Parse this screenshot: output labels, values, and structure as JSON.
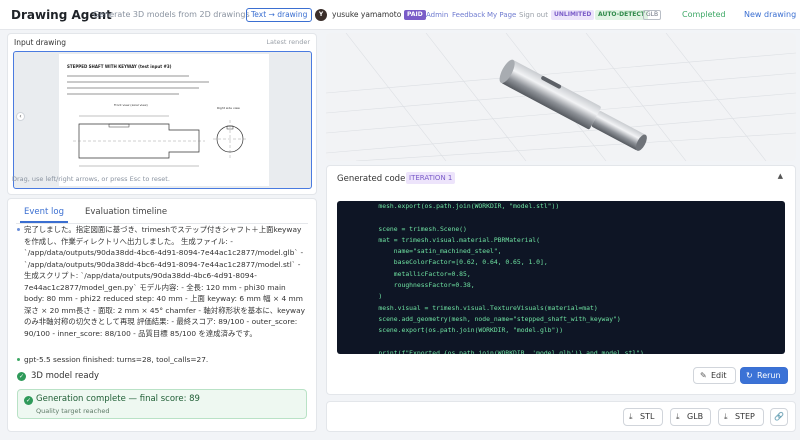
{
  "header": {
    "title": "Drawing Agent",
    "subtitle": "Generate 3D models from 2D drawings",
    "mode": "Text → drawing",
    "avatar_initial": "Y",
    "user_name": "yusuke yamamoto",
    "paid_badge": "PAID",
    "links": {
      "admin": "Admin",
      "feedback": "Feedback",
      "my_page": "My Page",
      "sign_out": "Sign out"
    },
    "unlimited_badge": "UNLIMITED",
    "auto_detect_badge": "AUTO-DETECT",
    "glb_badge": "GLB",
    "status": "Completed",
    "new_drawing": "New drawing",
    "status_color": "#3ea866",
    "accent": "#3b6fd1"
  },
  "input_drawing": {
    "label": "Input drawing",
    "latest": "Latest render",
    "drawing_title": "STEPPED SHAFT WITH KEYWAY (test input #3)",
    "front_view": "Front view (axial view)",
    "right_view": "Right side view",
    "hint": "Drag, use left/right arrows, or press Esc to reset."
  },
  "event_log": {
    "tabs": [
      "Event log",
      "Evaluation timeline"
    ],
    "entries": [
      {
        "text": "完了しました。指定図面に基づき、trimeshでステップ付きシャフト＋上面keywayを作成し、作業ディレクトリへ出力しました。 生成ファイル: - `/app/data/outputs/90da38dd-4bc6-4d91-8094-7e44ac1c2877/model.glb` - `/app/data/outputs/90da38dd-4bc6-4d91-8094-7e44ac1c2877/model.stl` - 生成スクリプト: `/app/data/outputs/90da38dd-4bc6-4d91-8094-7e44ac1c2877/model_gen.py` モデル内容: - 全長: 120 mm - phi30 main body: 80 mm - phi22 reduced step: 40 mm - 上面 keyway: 6 mm 幅 × 4 mm深さ × 20 mm長さ - 面取: 2 mm × 45° chamfer - 軸対称形状を基本に、keywayのみ非軸対称の切欠きとして再現 評価結果: - 最終スコア: 89/100 - outer_score: 90/100 - inner_score: 88/100 - 品質目標 85/100 を達成済みです。"
      },
      {
        "text": "gpt-5.5 session finished: turns=28, tool_calls=27."
      }
    ],
    "ready": "3D model ready",
    "success_title": "Generation complete — final score: 89",
    "success_sub": "Quality target reached"
  },
  "code_panel": {
    "title": "Generated code",
    "badge": "ITERATION 1",
    "code": "    mesh.export(os.path.join(WORKDIR, \"model.stl\"))\n\n    scene = trimesh.Scene()\n    mat = trimesh.visual.material.PBRMaterial(\n        name=\"satin_machined_steel\",\n        baseColorFactor=[0.62, 0.64, 0.65, 1.0],\n        metallicFactor=0.85,\n        roughnessFactor=0.38,\n    )\n    mesh.visual = trimesh.visual.TextureVisuals(material=mat)\n    scene.add_geometry(mesh, node_name=\"stepped_shaft_with_keyway\")\n    scene.export(os.path.join(WORKDIR, \"model.glb\"))\n\n    print(f\"Exported {os.path.join(WORKDIR, 'model.glb')} and model.stl\")\n    print(f\"Bounds (mm): {mesh.bounds}\")\n    print(f\"Watertight: {mesh.is_watertight}, faces: {len(mesh.faces)}, vertices: {len(mesh.vertices)}\")",
    "edit": "Edit",
    "rerun": "Rerun"
  },
  "export": {
    "stl": "STL",
    "glb": "GLB",
    "step": "STEP"
  }
}
